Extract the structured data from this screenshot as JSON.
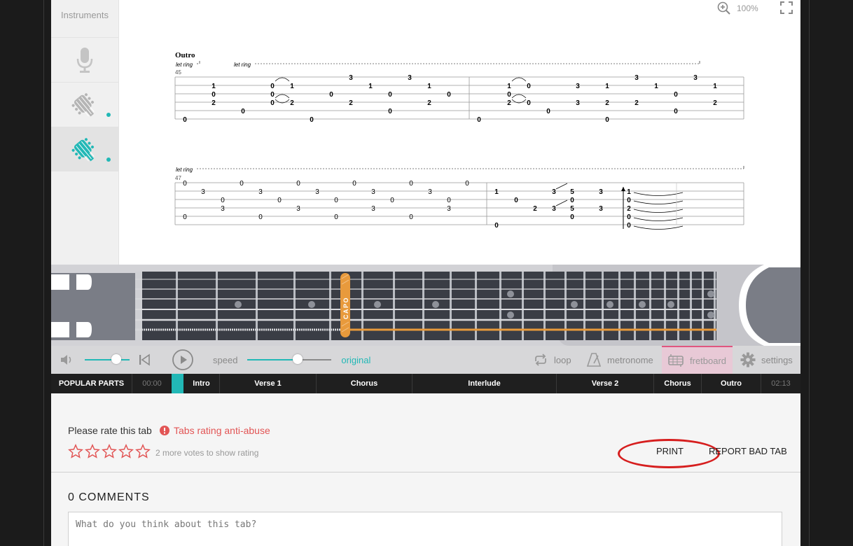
{
  "instruments": {
    "title": "Instruments",
    "items": [
      {
        "icon": "microphone-icon"
      },
      {
        "icon": "guitar-headstock-icon"
      },
      {
        "icon": "guitar-headstock-icon",
        "active": true
      }
    ]
  },
  "viewer": {
    "zoom": "100%"
  },
  "tab": {
    "section": "Outro",
    "let_ring": "let ring",
    "bar_45": "45",
    "bar_47": "47"
  },
  "fretboard": {
    "capo_label": "CAPO"
  },
  "controls": {
    "speed_label": "speed",
    "speed_value": "original",
    "loop_label": "loop",
    "metronome_label": "metronome",
    "fretboard_label": "fretboard",
    "settings_label": "settings",
    "volume_level": 0.7,
    "speed_level": 0.6
  },
  "popular_parts": {
    "title": "POPULAR PARTS",
    "start_time": "00:00",
    "end_time": "02:13",
    "parts": [
      "Intro",
      "Verse 1",
      "Chorus",
      "Interlude",
      "Verse 2",
      "Chorus",
      "Outro"
    ]
  },
  "rating": {
    "prompt": "Please rate this tab",
    "anti_abuse": "Tabs rating anti-abuse",
    "votes_note": "2 more votes to show rating",
    "stars": 5
  },
  "actions": {
    "print": "PRINT",
    "report": "REPORT BAD TAB"
  },
  "comments": {
    "title": "0 COMMENTS",
    "placeholder": "What do you think about this tab?"
  },
  "colors": {
    "accent": "#22b8b6",
    "capo": "#e89a3c",
    "annotation": "#d61e1e",
    "warning": "#e25555"
  }
}
